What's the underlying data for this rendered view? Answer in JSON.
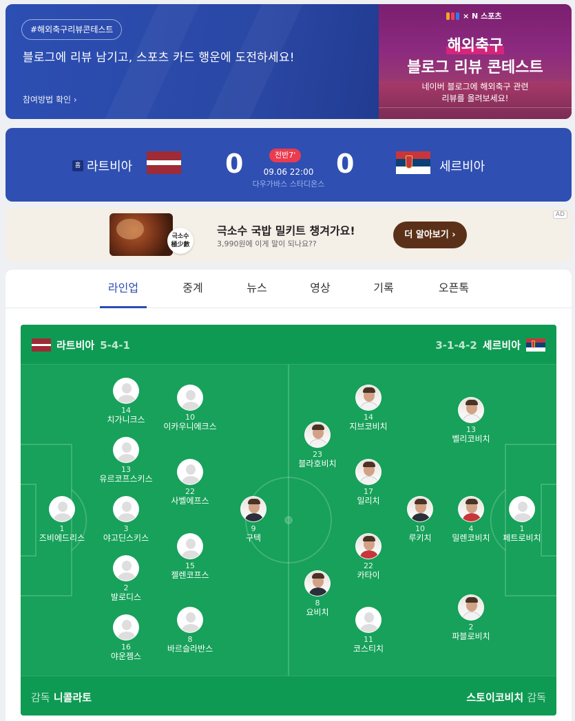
{
  "banner": {
    "tag": "#해외축구리뷰콘테스트",
    "headline": "블로그에 리뷰 남기고, 스포츠 카드 행운에 도전하세요!",
    "link": "참여방법 확인 ›",
    "logo_text": "× N 스포츠",
    "title_line1": "해외축구",
    "title_line2": "블로그 리뷰 콘테스트",
    "sub_line1": "네이버 블로그에 해외축구 관련",
    "sub_line2": "리뷰를 올려보세요!"
  },
  "match": {
    "home_badge": "홈",
    "home_team": "라트비아",
    "away_team": "세르비아",
    "home_score": "0",
    "away_score": "0",
    "period": "전반7'",
    "datetime": "09.06 22:00",
    "stadium": "다우가바스 스타디온스"
  },
  "ad": {
    "badge_line1": "극소수",
    "badge_line2": "極少數",
    "title": "극소수 국밥 밀키트 챙겨가요!",
    "subtitle": "3,990원에 이게 말이 되나요??",
    "button": "더 알아보기 ›",
    "label": "AD"
  },
  "tabs": [
    "라인업",
    "중계",
    "뉴스",
    "영상",
    "기록",
    "오픈톡"
  ],
  "lineup": {
    "home_name": "라트비아",
    "home_formation": "5-4-1",
    "away_name": "세르비아",
    "away_formation": "3-1-4-2",
    "coach_label": "감독",
    "home_coach": "니콜라토",
    "away_coach": "스토이코비치",
    "home_players": [
      {
        "num": "1",
        "name": "즈비에드리스"
      },
      {
        "num": "14",
        "name": "치가니크스"
      },
      {
        "num": "13",
        "name": "유르코프스키스"
      },
      {
        "num": "3",
        "name": "야고딘스키스"
      },
      {
        "num": "2",
        "name": "발로디스"
      },
      {
        "num": "16",
        "name": "야운젬스"
      },
      {
        "num": "10",
        "name": "이카우니에크스"
      },
      {
        "num": "22",
        "name": "사벨에프스"
      },
      {
        "num": "15",
        "name": "젤렌코프스"
      },
      {
        "num": "8",
        "name": "바르슬라반스"
      },
      {
        "num": "9",
        "name": "구텍"
      }
    ],
    "away_players": [
      {
        "num": "1",
        "name": "페트로비치"
      },
      {
        "num": "13",
        "name": "벨리코비치"
      },
      {
        "num": "4",
        "name": "밀렌코비치"
      },
      {
        "num": "2",
        "name": "파블로비치"
      },
      {
        "num": "10",
        "name": "루키치"
      },
      {
        "num": "14",
        "name": "지브코비치"
      },
      {
        "num": "17",
        "name": "일리치"
      },
      {
        "num": "22",
        "name": "카타이"
      },
      {
        "num": "11",
        "name": "코스티치"
      },
      {
        "num": "23",
        "name": "블라호비치"
      },
      {
        "num": "8",
        "name": "요비치"
      }
    ]
  },
  "colors": {
    "brand_blue": "#2f4fb2",
    "pitch_green": "#17a15a",
    "live_red": "#ea3b4f"
  }
}
